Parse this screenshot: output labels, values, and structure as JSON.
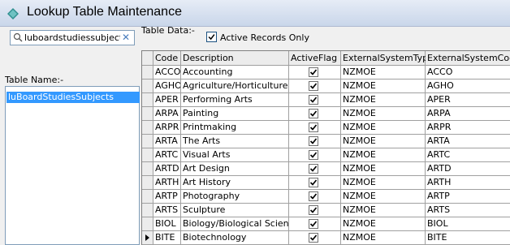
{
  "window": {
    "title": "Lookup Table Maintenance"
  },
  "search": {
    "value": "luboardstudiessubjects"
  },
  "left": {
    "table_name_label": "Table Name:-",
    "tables": [
      "luBoardStudiesSubjects"
    ]
  },
  "right": {
    "table_data_label": "Table Data:-",
    "active_only_label": "Active Records Only",
    "active_only_checked": true
  },
  "grid": {
    "columns": [
      "Code",
      "Description",
      "ActiveFlag",
      "ExternalSystemType",
      "ExternalSystemCode"
    ],
    "rows": [
      {
        "code": "ACCO",
        "desc": "Accounting",
        "active": true,
        "ext": "NZMOE",
        "extc": "ACCO"
      },
      {
        "code": "AGHO",
        "desc": "Agriculture/Horticulture",
        "active": true,
        "ext": "NZMOE",
        "extc": "AGHO"
      },
      {
        "code": "APER",
        "desc": "Performing Arts",
        "active": true,
        "ext": "NZMOE",
        "extc": "APER"
      },
      {
        "code": "ARPA",
        "desc": "Painting",
        "active": true,
        "ext": "NZMOE",
        "extc": "ARPA"
      },
      {
        "code": "ARPR",
        "desc": "Printmaking",
        "active": true,
        "ext": "NZMOE",
        "extc": "ARPR"
      },
      {
        "code": "ARTA",
        "desc": "The Arts",
        "active": true,
        "ext": "NZMOE",
        "extc": "ARTA"
      },
      {
        "code": "ARTC",
        "desc": "Visual Arts",
        "active": true,
        "ext": "NZMOE",
        "extc": "ARTC"
      },
      {
        "code": "ARTD",
        "desc": "Art Design",
        "active": true,
        "ext": "NZMOE",
        "extc": "ARTD"
      },
      {
        "code": "ARTH",
        "desc": "Art History",
        "active": true,
        "ext": "NZMOE",
        "extc": "ARTH"
      },
      {
        "code": "ARTP",
        "desc": "Photography",
        "active": true,
        "ext": "NZMOE",
        "extc": "ARTP"
      },
      {
        "code": "ARTS",
        "desc": "Sculpture",
        "active": true,
        "ext": "NZMOE",
        "extc": "ARTS"
      },
      {
        "code": "BIOL",
        "desc": "Biology/Biological Sciences",
        "active": true,
        "ext": "NZMOE",
        "extc": "BIOL"
      },
      {
        "code": "BITE",
        "desc": "Biotechnology",
        "active": true,
        "ext": "NZMOE",
        "extc": "BITE",
        "current": true
      }
    ]
  }
}
